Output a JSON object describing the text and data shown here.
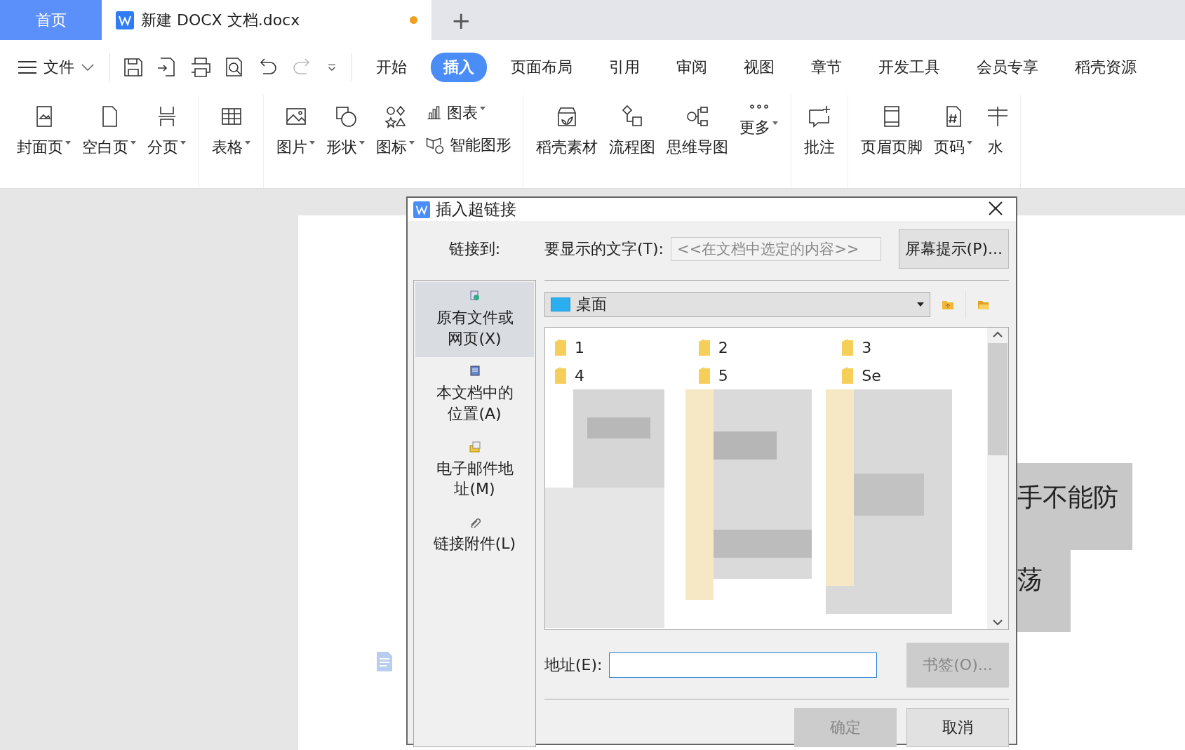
{
  "tabs": [
    {
      "label": "首页",
      "kind": "home",
      "selected": false
    },
    {
      "label": "新建 DOCX 文档.docx",
      "kind": "document",
      "selected": true,
      "unsaved": true
    }
  ],
  "new_tab": "+",
  "file_menu": "文件",
  "menu_tabs": [
    {
      "label": "开始",
      "selected": false
    },
    {
      "label": "插入",
      "selected": true
    },
    {
      "label": "页面布局",
      "selected": false
    },
    {
      "label": "引用",
      "selected": false
    },
    {
      "label": "审阅",
      "selected": false
    },
    {
      "label": "视图",
      "selected": false
    },
    {
      "label": "章节",
      "selected": false
    },
    {
      "label": "开发工具",
      "selected": false
    },
    {
      "label": "会员专享",
      "selected": false
    },
    {
      "label": "稻壳资源",
      "selected": false
    }
  ],
  "ribbon_groups": [
    [
      {
        "label": "封面页",
        "caret": true
      },
      {
        "label": "空白页",
        "caret": true
      },
      {
        "label": "分页",
        "caret": true
      }
    ],
    [
      {
        "label": "表格",
        "caret": true
      }
    ],
    [
      {
        "label": "图片",
        "caret": true
      },
      {
        "label": "形状",
        "caret": true
      },
      {
        "label": "图标",
        "caret": true
      },
      {
        "label": "图表",
        "caret": true,
        "kind": "small"
      },
      {
        "label": "智能图形",
        "caret": false,
        "kind": "small"
      }
    ],
    [
      {
        "label": "稻壳素材",
        "caret": false
      },
      {
        "label": "流程图",
        "caret": false
      },
      {
        "label": "思维导图",
        "caret": false
      },
      {
        "label": "更多",
        "caret": true
      }
    ],
    [
      {
        "label": "批注",
        "caret": false
      }
    ],
    [
      {
        "label": "页眉页脚",
        "caret": false
      },
      {
        "label": "页码",
        "caret": true
      },
      {
        "label": "水",
        "caret": false
      }
    ]
  ],
  "document_lines": [
    "手不能防",
    "荡"
  ],
  "dialog": {
    "title": "插入超链接",
    "link_to_label": "链接到:",
    "display_text_label": "要显示的文字(T):",
    "display_text_placeholder": "<<在文档中选定的内容>>",
    "screen_tip_button": "屏幕提示(P)...",
    "link_types": [
      {
        "label": "原有文件或网页(X)",
        "selected": true
      },
      {
        "label": "本文档中的位置(A)",
        "selected": false
      },
      {
        "label": "电子邮件地址(M)",
        "selected": false
      },
      {
        "label": "链接附件(L)",
        "selected": false
      }
    ],
    "folder": "桌面",
    "files": [
      {
        "name": "1"
      },
      {
        "name": "2"
      },
      {
        "name": "3"
      },
      {
        "name": "4"
      },
      {
        "name": "5"
      },
      {
        "name": "Se"
      }
    ],
    "address_label": "地址(E):",
    "bookmark_button": {
      "label": "书签(O)...",
      "disabled": true
    },
    "ok_button": {
      "label": "确定",
      "disabled": true
    },
    "cancel_button": {
      "label": "取消",
      "disabled": false
    }
  }
}
